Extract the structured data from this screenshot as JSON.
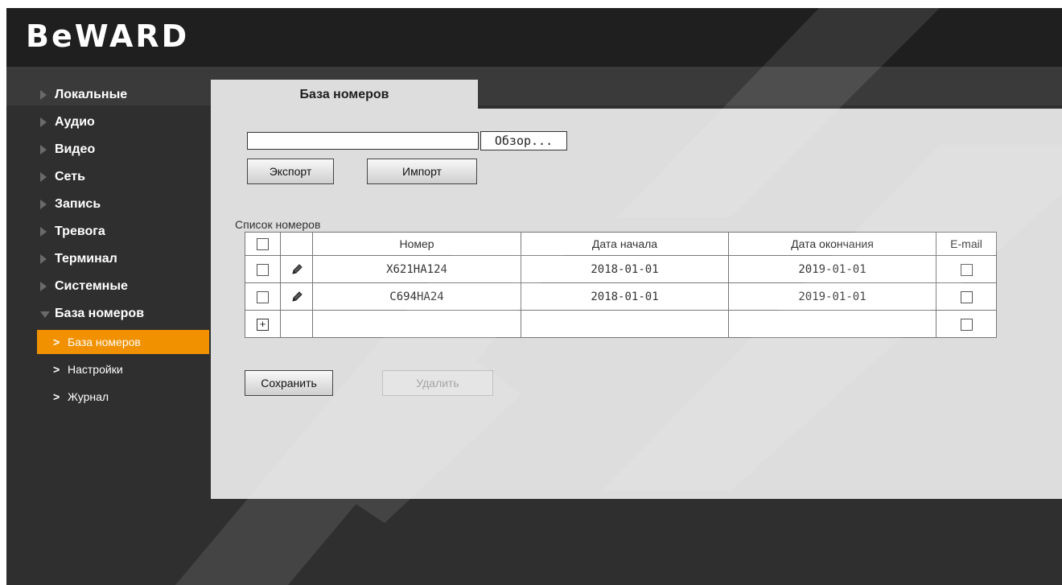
{
  "brand": {
    "logo_text": "BeWARD"
  },
  "sidebar": {
    "items": [
      {
        "label": "Локальные"
      },
      {
        "label": "Аудио"
      },
      {
        "label": "Видео"
      },
      {
        "label": "Сеть"
      },
      {
        "label": "Запись"
      },
      {
        "label": "Тревога"
      },
      {
        "label": "Терминал"
      },
      {
        "label": "Системные"
      },
      {
        "label": "База номеров"
      }
    ],
    "subitems": [
      {
        "label": "База номеров"
      },
      {
        "label": "Настройки"
      },
      {
        "label": "Журнал"
      }
    ]
  },
  "main": {
    "tab_label": "База номеров",
    "file_value": "",
    "browse_label": "Обзор...",
    "export_label": "Экспорт",
    "import_label": "Импорт",
    "list_label": "Список номеров",
    "table": {
      "headers": {
        "number": "Номер",
        "start": "Дата начала",
        "end": "Дата окончания",
        "email": "E-mail"
      },
      "rows": [
        {
          "number": "X621HA124",
          "start": "2018-01-01",
          "end": "2019-01-01",
          "email": false
        },
        {
          "number": "C694HA24",
          "start": "2018-01-01",
          "end": "2019-01-01",
          "email": false
        }
      ]
    },
    "save_label": "Сохранить",
    "delete_label": "Удалить"
  },
  "colors": {
    "accent": "#f29100",
    "content_bg": "#dddddd",
    "frame_bg": "#2f2f2f"
  },
  "icons": [
    "triangle-right-icon",
    "triangle-down-icon",
    "chevron-right-icon",
    "pencil-icon",
    "plus-icon",
    "checkbox-icon"
  ]
}
